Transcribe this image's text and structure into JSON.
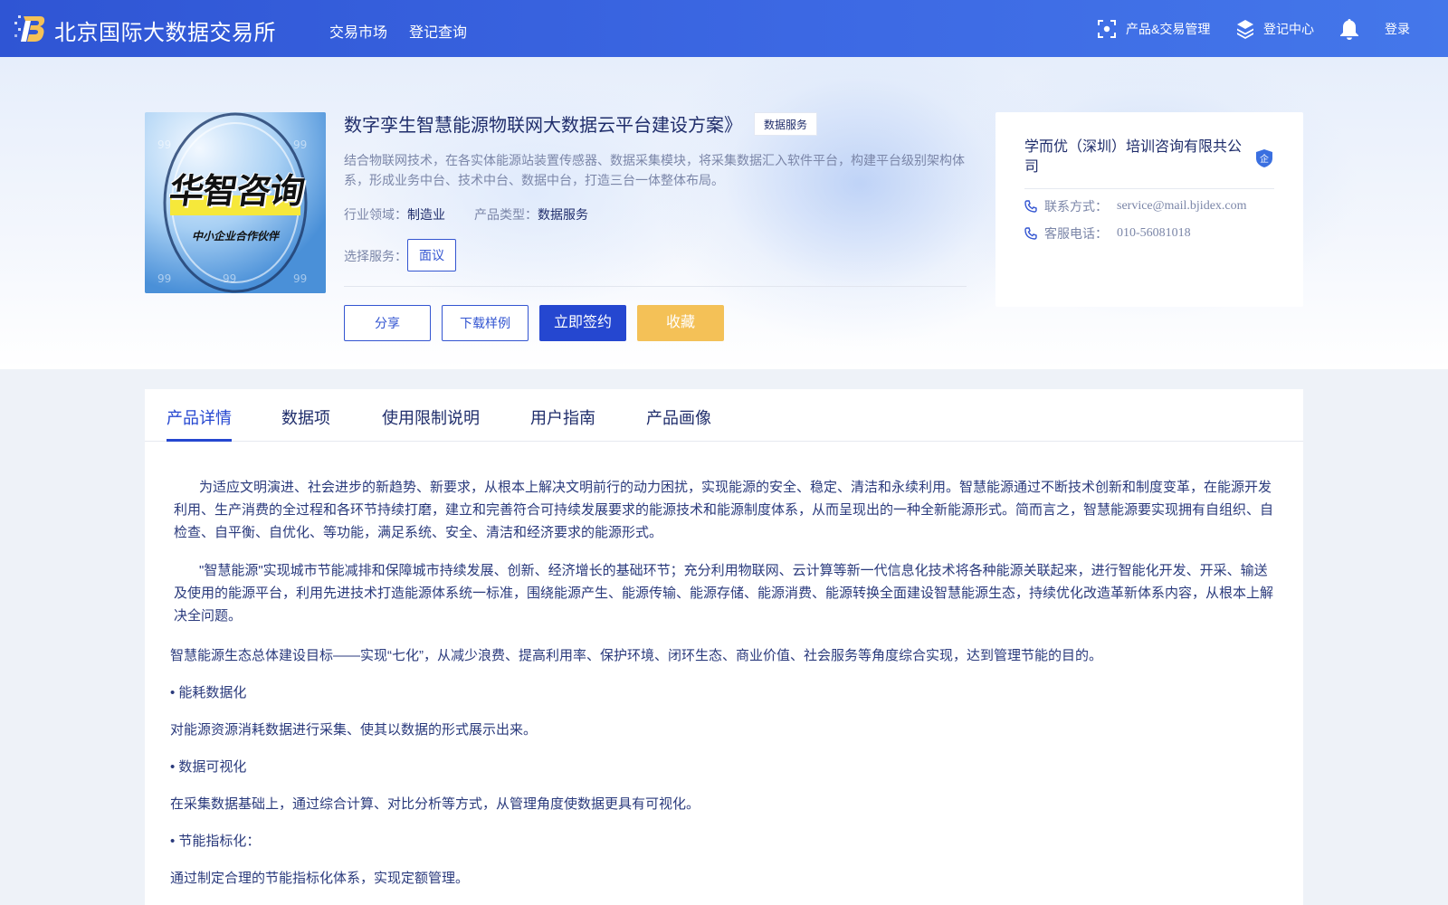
{
  "colors": {
    "nav_bg": "#3560db",
    "primary": "#2547d0",
    "accent_yellow": "#f4c157",
    "text_dark": "#1f2d6b",
    "text_muted": "#7b86a8"
  },
  "header": {
    "brand": "北京国际大数据交易所",
    "nav_links": [
      "交易市场",
      "登记查询"
    ],
    "product_mgmt": "产品&交易管理",
    "register_center": "登记中心",
    "login": "登录"
  },
  "product": {
    "image_caption_main": "华智咨询",
    "image_caption_sub": "中小企业合作伙伴",
    "title": "数字孪生智慧能源物联网大数据云平台建设方案》",
    "tag": "数据服务",
    "description": "结合物联网技术，在各实体能源站装置传感器、数据采集模块，将采集数据汇入软件平台，构建平台级别架构体系，形成业务中台、技术中台、数据中台，打造三台一体整体布局。",
    "industry_label": "行业领域：",
    "industry_value": "制造业",
    "type_label": "产品类型：",
    "type_value": "数据服务",
    "service_label": "选择服务：",
    "service_option": "面议",
    "buttons": {
      "share": "分享",
      "download": "下载样例",
      "sign": "立即签约",
      "favorite": "收藏"
    }
  },
  "company": {
    "name": "学而优（深圳）培训咨询有限共公司",
    "badge": "企",
    "contact_label": "联系方式：",
    "contact_value": "service@mail.bjidex.com",
    "phone_label": "客服电话：",
    "phone_value": "010-56081018"
  },
  "tabs": [
    "产品详情",
    "数据项",
    "使用限制说明",
    "用户指南",
    "产品画像"
  ],
  "active_tab": "产品详情",
  "detail": {
    "para1": "为适应文明演进、社会进步的新趋势、新要求，从根本上解决文明前行的动力困扰，实现能源的安全、稳定、清洁和永续利用。智慧能源通过不断技术创新和制度变革，在能源开发利用、生产消费的全过程和各环节持续打磨，建立和完善符合可持续发展要求的能源技术和能源制度体系，从而呈现出的一种全新能源形式。简而言之，智慧能源要实现拥有自组织、自检查、自平衡、自优化、等功能，满足系统、安全、清洁和经济要求的能源形式。",
    "para2": "\"智慧能源\"实现城市节能减排和保障城市持续发展、创新、经济增长的基础环节；充分利用物联网、云计算等新一代信息化技术将各种能源关联起来，进行智能化开发、开采、输送及使用的能源平台，利用先进技术打造能源体系统一标准，围绕能源产生、能源传输、能源存储、能源消费、能源转换全面建设智慧能源生态，持续优化改造革新体系内容，从根本上解决全问题。",
    "line1": "智慧能源生态总体建设目标——实现“七化”，从减少浪费、提高利用率、保护环境、闭环生态、商业价值、社会服务等角度综合实现，达到管理节能的目的。",
    "line2": "• 能耗数据化",
    "line3": "对能源资源消耗数据进行采集、使其以数据的形式展示出来。",
    "line4": "• 数据可视化",
    "line5": "在采集数据基础上，通过综合计算、对比分析等方式，从管理角度使数据更具有可视化。",
    "line6": "• 节能指标化：",
    "line7": "通过制定合理的节能指标化体系，实现定额管理。"
  }
}
